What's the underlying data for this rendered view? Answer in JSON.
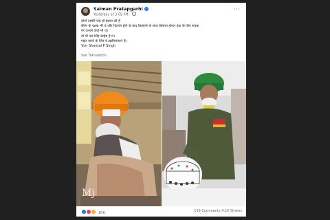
{
  "post": {
    "author": "Salman Pratapgarhi",
    "timestamp": "Yesterday at 3:09 PM",
    "lines": [
      "दोनों तस्वीरें एक ही इंसान की हैं",
      "सीमा के रक्षक भी थे और रिटायर होने के बाद किसानों के साथ किसान होकर हक़ के लिए सड़क",
      "पर उतरने वाले भी थे।",
      "वो पी एस सिंह साहेब हैं ये।",
      "गद्दार वालों के लिए ये ख़ामिलाफ़ने हैं।",
      "Via- Sheetal P Singh"
    ],
    "see_translation": "See Translation",
    "more_label": "···"
  },
  "footer": {
    "reactions_count": "10K",
    "comments": "193 Comments",
    "shares": "4.1K Shares"
  },
  "watermark": "Mj",
  "colors": {
    "page_bg": "#202020",
    "card_bg": "#ffffff",
    "link_blue": "#1877f2",
    "muted_text": "#65676b"
  },
  "icons": [
    "avatar",
    "verified-badge-icon",
    "globe-icon",
    "more-options-icon",
    "like-reaction-icon",
    "love-reaction-icon",
    "care-reaction-icon"
  ]
}
